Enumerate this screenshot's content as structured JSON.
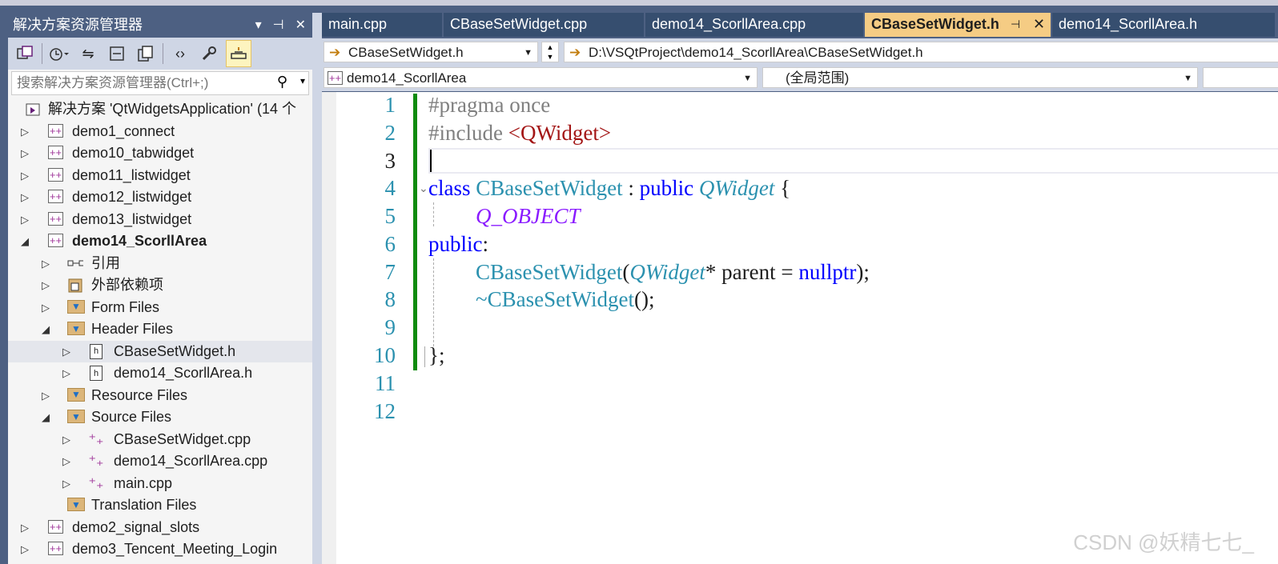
{
  "explorer": {
    "title": "解决方案资源管理器",
    "title_controls": [
      "▾",
      "⊣",
      "✕"
    ],
    "search_placeholder": "搜索解决方案资源管理器(Ctrl+;)",
    "solution_label": "解决方案 'QtWidgetsApplication' (14 个",
    "items": [
      {
        "label": "demo1_connect"
      },
      {
        "label": "demo10_tabwidget"
      },
      {
        "label": "demo11_listwidget"
      },
      {
        "label": "demo12_listwidget"
      },
      {
        "label": "demo13_listwidget"
      },
      {
        "label": "demo14_ScorllArea"
      },
      {
        "label": "引用"
      },
      {
        "label": "外部依赖项"
      },
      {
        "label": "Form Files"
      },
      {
        "label": "Header Files"
      },
      {
        "label": "CBaseSetWidget.h"
      },
      {
        "label": "demo14_ScorllArea.h"
      },
      {
        "label": "Resource Files"
      },
      {
        "label": "Source Files"
      },
      {
        "label": "CBaseSetWidget.cpp"
      },
      {
        "label": "demo14_ScorllArea.cpp"
      },
      {
        "label": "main.cpp"
      },
      {
        "label": "Translation Files"
      },
      {
        "label": "demo2_signal_slots"
      },
      {
        "label": "demo3_Tencent_Meeting_Login"
      }
    ]
  },
  "tabs": [
    {
      "label": "main.cpp"
    },
    {
      "label": "CBaseSetWidget.cpp"
    },
    {
      "label": "demo14_ScorllArea.cpp"
    },
    {
      "label": "CBaseSetWidget.h",
      "active": true
    },
    {
      "label": "demo14_ScorllArea.h"
    }
  ],
  "tab_pin": "⊣",
  "tab_close": "✕",
  "nav": {
    "file_combo": "CBaseSetWidget.h",
    "path": "D:\\VSQtProject\\demo14_ScorllArea\\CBaseSetWidget.h",
    "project_combo": "demo14_ScorllArea",
    "scope_combo": "(全局范围)"
  },
  "editor": {
    "line_numbers": [
      "1",
      "2",
      "3",
      "4",
      "5",
      "6",
      "7",
      "8",
      "9",
      "10",
      "11",
      "12"
    ],
    "lines": {
      "l1_pp": "#pragma once",
      "l2_pp": "#include ",
      "l2_str": "<QWidget>",
      "l4_kw": "class ",
      "l4_ty": "CBaseSetWidget",
      "l4_colon": " : ",
      "l4_kw2": "public ",
      "l4_base": "QWidget",
      "l4_brace": " {",
      "l5_mac": "Q_OBJECT",
      "l6_kw": "public",
      "l6_colon": ":",
      "l7_fn": "CBaseSetWidget",
      "l7_paren": "(",
      "l7_ty": "QWidget",
      "l7_rest": "* parent = ",
      "l7_kw": "nullptr",
      "l7_end": ");",
      "l8_tilde": "~",
      "l8_fn": "CBaseSetWidget",
      "l8_end": "();",
      "l10": "};"
    }
  },
  "watermark": "CSDN @妖精七七_",
  "colors": {
    "accent_tab": "#f5cc84",
    "frame": "#4d6082",
    "change_bar": "#108b0f",
    "keyword": "#0000ff",
    "type": "#2b91af",
    "string": "#a31515",
    "macro": "#8a1bff"
  }
}
